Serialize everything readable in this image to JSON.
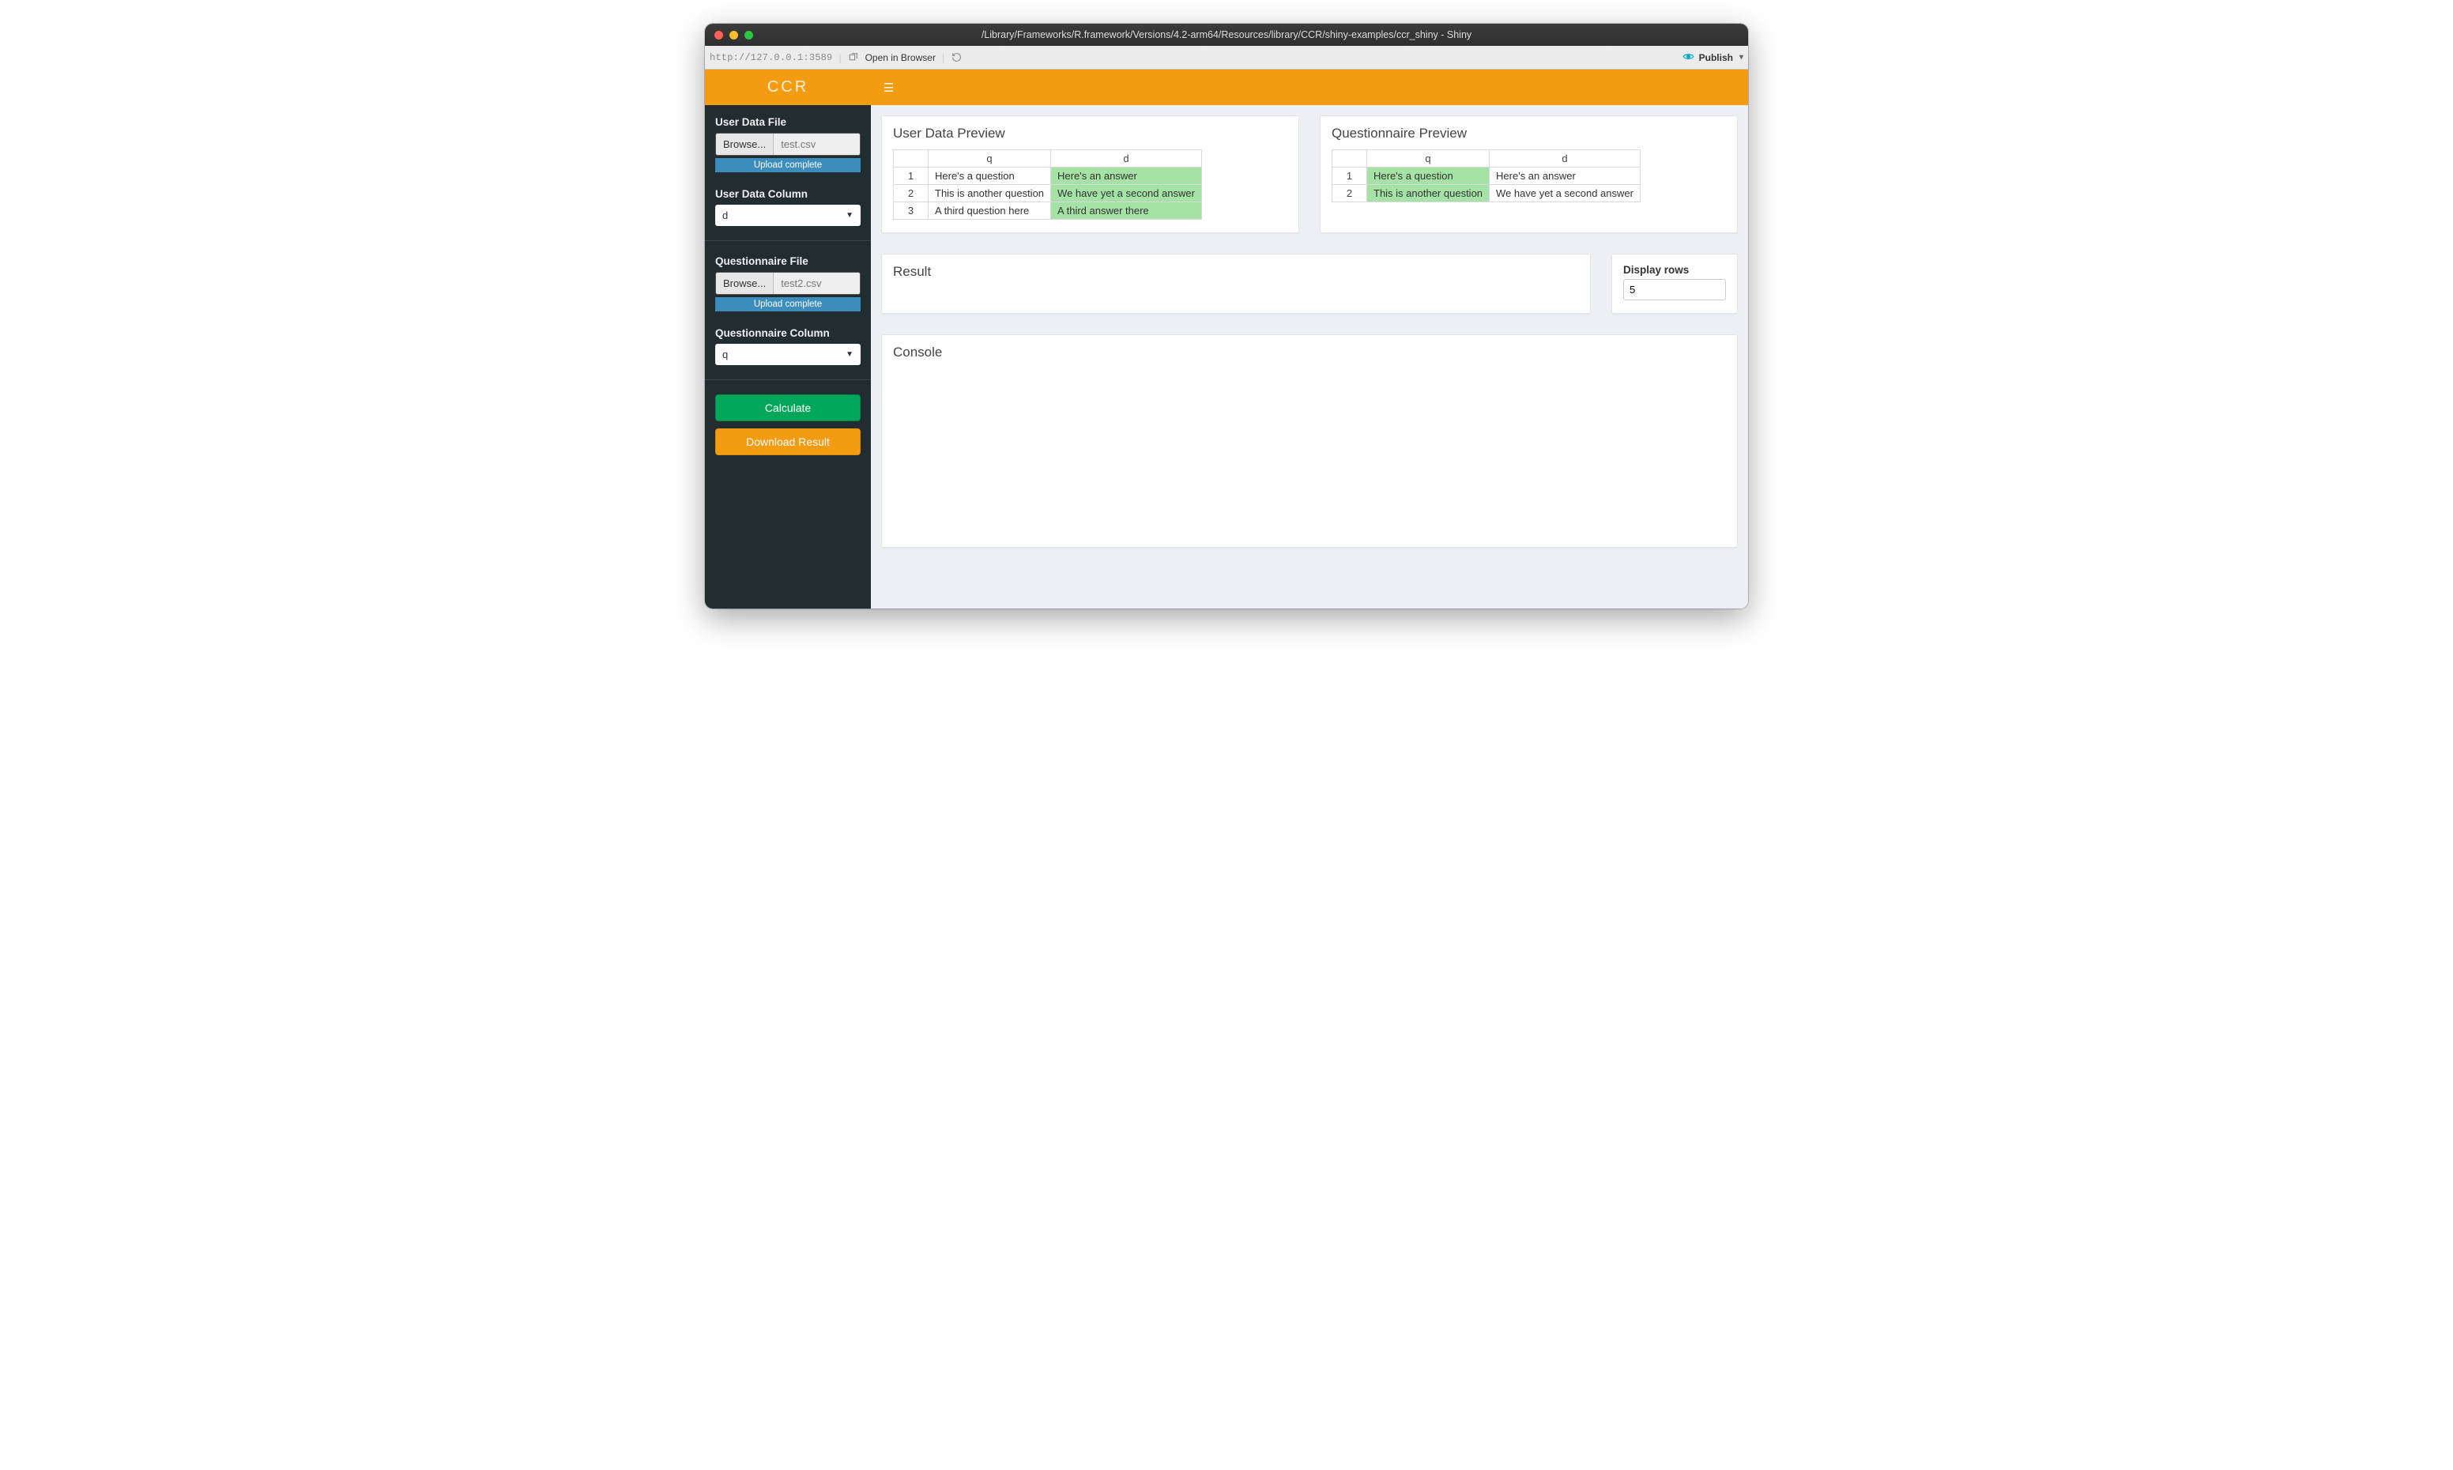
{
  "window": {
    "title": "/Library/Frameworks/R.framework/Versions/4.2-arm64/Resources/library/CCR/shiny-examples/ccr_shiny - Shiny"
  },
  "toolbar": {
    "url": "http://127.0.0.1:3589",
    "open_in_browser": "Open in Browser",
    "publish": "Publish"
  },
  "header": {
    "logo": "CCR"
  },
  "sidebar": {
    "user_data_file_label": "User Data File",
    "browse_label": "Browse...",
    "user_file_name": "test.csv",
    "upload_complete": "Upload complete",
    "user_data_column_label": "User Data Column",
    "user_data_column_value": "d",
    "questionnaire_file_label": "Questionnaire File",
    "questionnaire_file_name": "test2.csv",
    "questionnaire_column_label": "Questionnaire Column",
    "questionnaire_column_value": "q",
    "calculate_label": "Calculate",
    "download_label": "Download Result"
  },
  "panels": {
    "user_preview_title": "User Data Preview",
    "questionnaire_preview_title": "Questionnaire Preview",
    "result_title": "Result",
    "console_title": "Console",
    "display_rows_label": "Display rows",
    "display_rows_value": "5"
  },
  "user_table": {
    "headers": {
      "blank": "",
      "q": "q",
      "d": "d"
    },
    "rows": [
      {
        "n": "1",
        "q": "Here's a question",
        "d": "Here's an answer",
        "hl": "d"
      },
      {
        "n": "2",
        "q": "This is another question",
        "d": "We have yet a second answer",
        "hl": "d"
      },
      {
        "n": "3",
        "q": "A third question here",
        "d": "A third answer there",
        "hl": "d"
      }
    ]
  },
  "quest_table": {
    "headers": {
      "blank": "",
      "q": "q",
      "d": "d"
    },
    "rows": [
      {
        "n": "1",
        "q": "Here's a question",
        "d": "Here's an answer",
        "hl": "q"
      },
      {
        "n": "2",
        "q": "This is another question",
        "d": "We have yet a second answer",
        "hl": "q"
      }
    ]
  }
}
